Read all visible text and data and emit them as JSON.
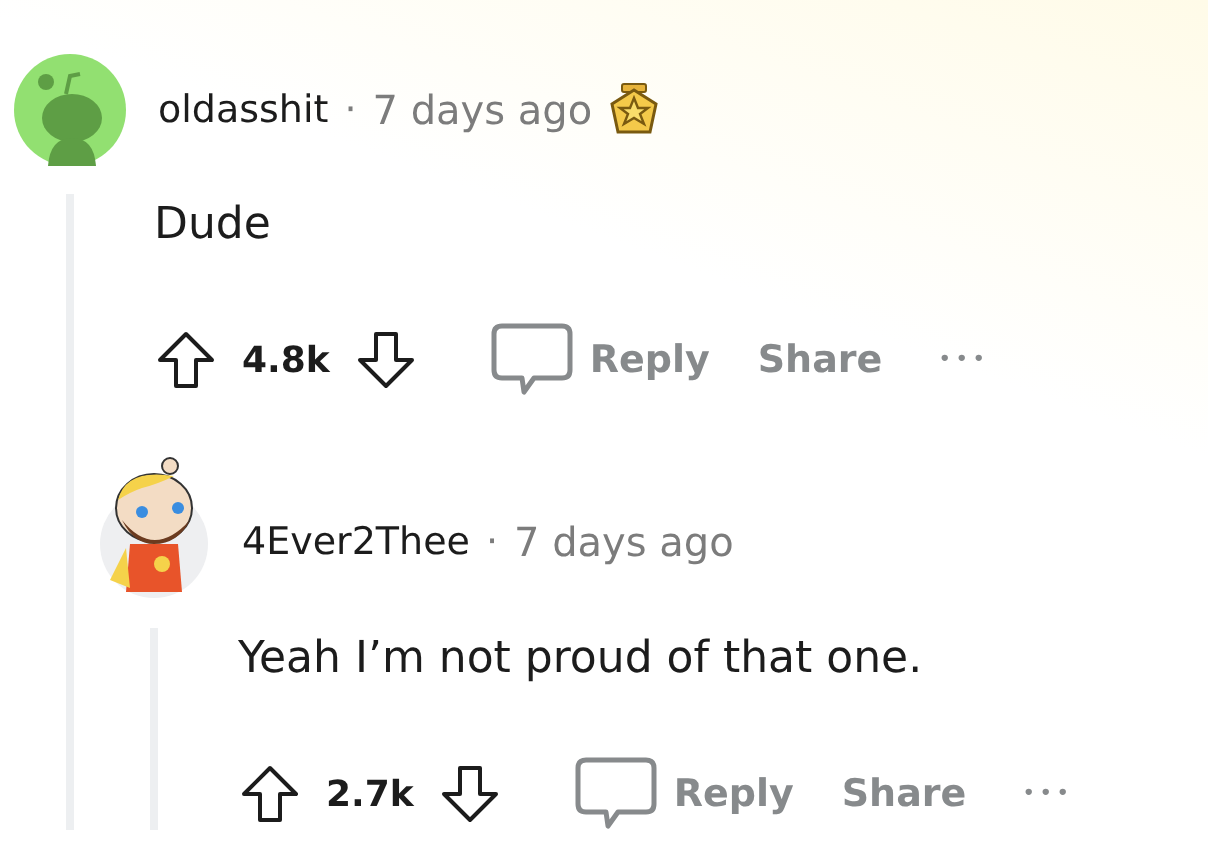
{
  "comments": [
    {
      "kind": "robot",
      "username": "oldasshit",
      "separator": "·",
      "time": "7 days ago",
      "award": true,
      "body": "Dude",
      "score": "4.8k",
      "actions": [
        "Reply",
        "Share"
      ],
      "more": "•••",
      "children": [
        {
          "kind": "character",
          "username": "4Ever2Thee",
          "separator": "·",
          "time": "7 days ago",
          "award": false,
          "body": "Yeah I’m not proud of that one.",
          "score": "2.7k",
          "actions": [
            "Reply",
            "Share"
          ],
          "more": "•••"
        }
      ]
    }
  ]
}
